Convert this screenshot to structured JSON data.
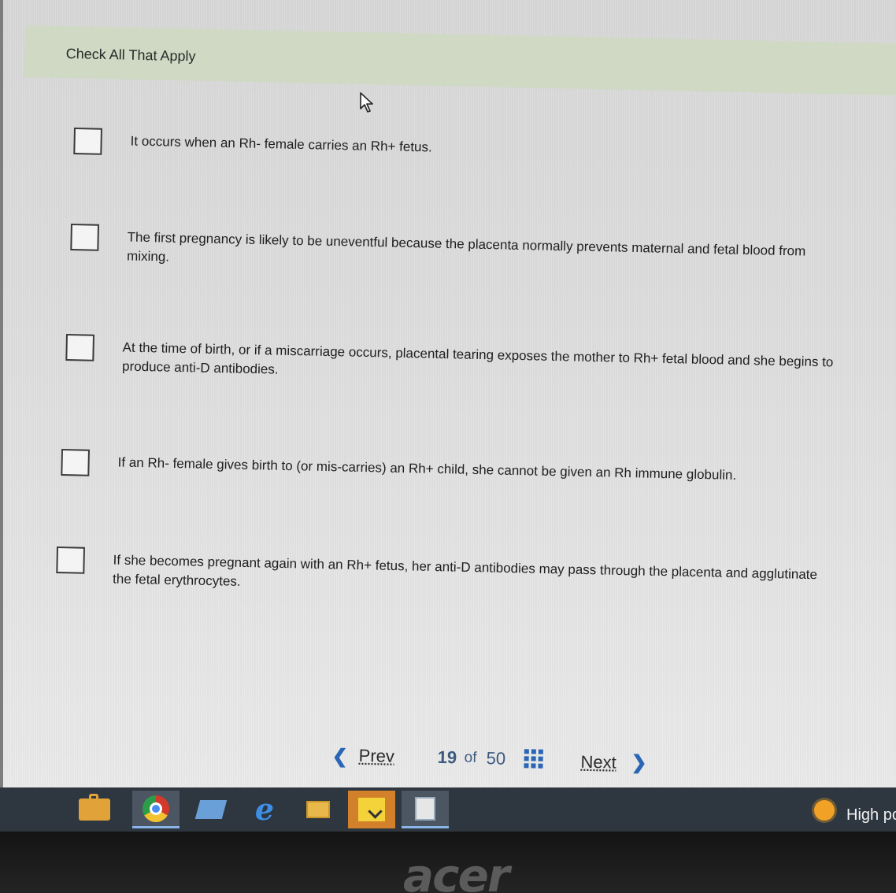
{
  "question": {
    "instruction": "Check All That Apply",
    "options": [
      {
        "text": "It occurs when an Rh- female carries an Rh+ fetus.",
        "checked": false
      },
      {
        "text": "The first pregnancy is likely to be uneventful because the placenta normally prevents maternal and fetal blood from mixing.",
        "checked": false
      },
      {
        "text": "At the time of birth, or if a miscarriage occurs, placental tearing exposes the mother to Rh+ fetal blood and she begins to produce anti-D antibodies.",
        "checked": false
      },
      {
        "text": "If an Rh- female gives birth to (or mis-carries) an Rh+ child, she cannot be given an Rh immune globulin.",
        "checked": false
      },
      {
        "text": "If she becomes pregnant again with an Rh+ fetus, her anti-D antibodies may pass through the placenta and agglutinate the fetal erythrocytes.",
        "checked": false
      }
    ]
  },
  "pagination": {
    "prev_label": "Prev",
    "current": "19",
    "of_label": "of",
    "total": "50",
    "next_label": "Next",
    "prev_icon": "chevron-left-icon",
    "next_icon": "chevron-right-icon",
    "grid_icon": "grid-icon"
  },
  "taskbar": {
    "items": [
      "briefcase-icon",
      "chrome-icon",
      "pc-icon",
      "edge-icon",
      "file-explorer-icon",
      "sticky-notes-icon",
      "calculator-icon"
    ],
    "tray_text": "High pc"
  },
  "bezel": {
    "brand": "acer"
  },
  "colors": {
    "header_band": "#cfd9c4",
    "accent_blue": "#2a66b5",
    "taskbar": "#2e3740"
  }
}
